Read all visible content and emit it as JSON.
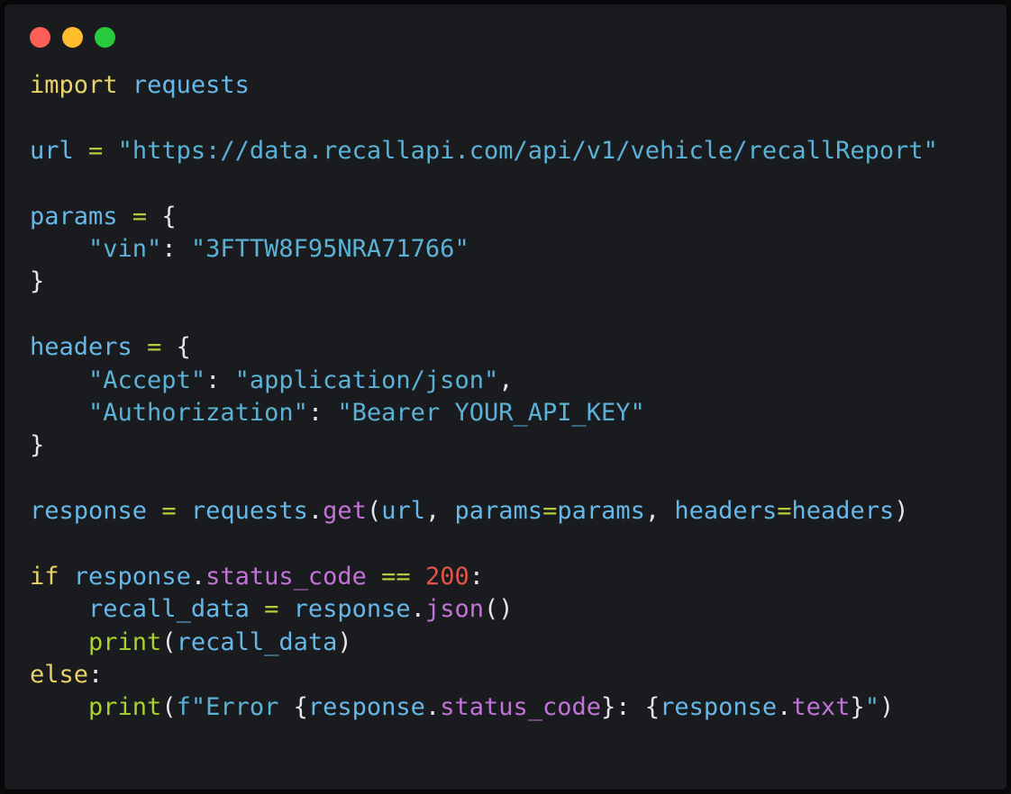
{
  "window": {
    "theme": "dark",
    "background_color": "#1a1b1e",
    "border_color": "#08080a",
    "traffic_lights": [
      {
        "name": "close",
        "label": "Close",
        "color": "#ff5f56"
      },
      {
        "name": "minimize",
        "label": "Minimize",
        "color": "#ffbd2e"
      },
      {
        "name": "maximize",
        "label": "Maximize",
        "color": "#27c93f"
      }
    ]
  },
  "editor": {
    "language": "python",
    "syntax_colors": {
      "keyword": "#e8d26a",
      "variable": "#66b8e8",
      "string": "#5ab2d6",
      "operator": "#b5cc3a",
      "punctuation": "#e6e6e6",
      "function": "#c173d6",
      "builtin": "#a6d132",
      "number": "#e2544a"
    },
    "values": {
      "module": "requests",
      "url": "https://data.recallapi.com/api/v1/vehicle/recallReport",
      "vin_key": "vin",
      "vin": "3FTTW8F95NRA71766",
      "accept_key": "Accept",
      "accept_value": "application/json",
      "authorization_key": "Authorization",
      "authorization_value": "Bearer YOUR_API_KEY",
      "status_code_ok": "200",
      "error_message": "Error"
    },
    "lines": [
      {
        "n": 1,
        "text": "import requests",
        "tokens": [
          {
            "t": "import",
            "c": "keyword"
          },
          {
            "t": " ",
            "c": "punctuation"
          },
          {
            "t": "requests",
            "c": "variable"
          }
        ]
      },
      {
        "n": 2,
        "text": "",
        "tokens": []
      },
      {
        "n": 3,
        "text": "url = \"https://data.recallapi.com/api/v1/vehicle/recallReport\"",
        "tokens": [
          {
            "t": "url",
            "c": "variable"
          },
          {
            "t": " ",
            "c": "punctuation"
          },
          {
            "t": "=",
            "c": "operator"
          },
          {
            "t": " ",
            "c": "punctuation"
          },
          {
            "t": "\"https://data.recallapi.com/api/v1/vehicle/recallReport\"",
            "c": "string"
          }
        ]
      },
      {
        "n": 4,
        "text": "",
        "tokens": []
      },
      {
        "n": 5,
        "text": "params = {",
        "tokens": [
          {
            "t": "params",
            "c": "variable"
          },
          {
            "t": " ",
            "c": "punctuation"
          },
          {
            "t": "=",
            "c": "operator"
          },
          {
            "t": " ",
            "c": "punctuation"
          },
          {
            "t": "{",
            "c": "punctuation"
          }
        ]
      },
      {
        "n": 6,
        "text": "    \"vin\": \"3FTTW8F95NRA71766\"",
        "tokens": [
          {
            "t": "    ",
            "c": "punctuation"
          },
          {
            "t": "\"vin\"",
            "c": "string"
          },
          {
            "t": ":",
            "c": "punctuation"
          },
          {
            "t": " ",
            "c": "punctuation"
          },
          {
            "t": "\"3FTTW8F95NRA71766\"",
            "c": "string"
          }
        ]
      },
      {
        "n": 7,
        "text": "}",
        "tokens": [
          {
            "t": "}",
            "c": "punctuation"
          }
        ]
      },
      {
        "n": 8,
        "text": "",
        "tokens": []
      },
      {
        "n": 9,
        "text": "headers = {",
        "tokens": [
          {
            "t": "headers",
            "c": "variable"
          },
          {
            "t": " ",
            "c": "punctuation"
          },
          {
            "t": "=",
            "c": "operator"
          },
          {
            "t": " ",
            "c": "punctuation"
          },
          {
            "t": "{",
            "c": "punctuation"
          }
        ]
      },
      {
        "n": 10,
        "text": "    \"Accept\": \"application/json\",",
        "tokens": [
          {
            "t": "    ",
            "c": "punctuation"
          },
          {
            "t": "\"Accept\"",
            "c": "string"
          },
          {
            "t": ":",
            "c": "punctuation"
          },
          {
            "t": " ",
            "c": "punctuation"
          },
          {
            "t": "\"application/json\"",
            "c": "string"
          },
          {
            "t": ",",
            "c": "punctuation"
          }
        ]
      },
      {
        "n": 11,
        "text": "    \"Authorization\": \"Bearer YOUR_API_KEY\"",
        "tokens": [
          {
            "t": "    ",
            "c": "punctuation"
          },
          {
            "t": "\"Authorization\"",
            "c": "string"
          },
          {
            "t": ":",
            "c": "punctuation"
          },
          {
            "t": " ",
            "c": "punctuation"
          },
          {
            "t": "\"Bearer YOUR_API_KEY\"",
            "c": "string"
          }
        ]
      },
      {
        "n": 12,
        "text": "}",
        "tokens": [
          {
            "t": "}",
            "c": "punctuation"
          }
        ]
      },
      {
        "n": 13,
        "text": "",
        "tokens": []
      },
      {
        "n": 14,
        "text": "response = requests.get(url, params=params, headers=headers)",
        "tokens": [
          {
            "t": "response",
            "c": "variable"
          },
          {
            "t": " ",
            "c": "punctuation"
          },
          {
            "t": "=",
            "c": "operator"
          },
          {
            "t": " ",
            "c": "punctuation"
          },
          {
            "t": "requests",
            "c": "variable"
          },
          {
            "t": ".",
            "c": "punctuation"
          },
          {
            "t": "get",
            "c": "function"
          },
          {
            "t": "(",
            "c": "punctuation"
          },
          {
            "t": "url",
            "c": "variable"
          },
          {
            "t": ",",
            "c": "punctuation"
          },
          {
            "t": " ",
            "c": "punctuation"
          },
          {
            "t": "params",
            "c": "variable"
          },
          {
            "t": "=",
            "c": "operator"
          },
          {
            "t": "params",
            "c": "variable"
          },
          {
            "t": ",",
            "c": "punctuation"
          },
          {
            "t": " ",
            "c": "punctuation"
          },
          {
            "t": "headers",
            "c": "variable"
          },
          {
            "t": "=",
            "c": "operator"
          },
          {
            "t": "headers",
            "c": "variable"
          },
          {
            "t": ")",
            "c": "punctuation"
          }
        ]
      },
      {
        "n": 15,
        "text": "",
        "tokens": []
      },
      {
        "n": 16,
        "text": "if response.status_code == 200:",
        "tokens": [
          {
            "t": "if",
            "c": "keyword"
          },
          {
            "t": " ",
            "c": "punctuation"
          },
          {
            "t": "response",
            "c": "variable"
          },
          {
            "t": ".",
            "c": "punctuation"
          },
          {
            "t": "status_code",
            "c": "function"
          },
          {
            "t": " ",
            "c": "punctuation"
          },
          {
            "t": "==",
            "c": "operator"
          },
          {
            "t": " ",
            "c": "punctuation"
          },
          {
            "t": "200",
            "c": "number"
          },
          {
            "t": ":",
            "c": "punctuation"
          }
        ]
      },
      {
        "n": 17,
        "text": "    recall_data = response.json()",
        "tokens": [
          {
            "t": "    ",
            "c": "punctuation"
          },
          {
            "t": "recall_data",
            "c": "variable"
          },
          {
            "t": " ",
            "c": "punctuation"
          },
          {
            "t": "=",
            "c": "operator"
          },
          {
            "t": " ",
            "c": "punctuation"
          },
          {
            "t": "response",
            "c": "variable"
          },
          {
            "t": ".",
            "c": "punctuation"
          },
          {
            "t": "json",
            "c": "function"
          },
          {
            "t": "()",
            "c": "punctuation"
          }
        ]
      },
      {
        "n": 18,
        "text": "    print(recall_data)",
        "tokens": [
          {
            "t": "    ",
            "c": "punctuation"
          },
          {
            "t": "print",
            "c": "builtin"
          },
          {
            "t": "(",
            "c": "punctuation"
          },
          {
            "t": "recall_data",
            "c": "variable"
          },
          {
            "t": ")",
            "c": "punctuation"
          }
        ]
      },
      {
        "n": 19,
        "text": "else:",
        "tokens": [
          {
            "t": "else",
            "c": "keyword"
          },
          {
            "t": ":",
            "c": "punctuation"
          }
        ]
      },
      {
        "n": 20,
        "text": "    print(f\"Error {response.status_code}: {response.text}\")",
        "tokens": [
          {
            "t": "    ",
            "c": "punctuation"
          },
          {
            "t": "print",
            "c": "builtin"
          },
          {
            "t": "(",
            "c": "punctuation"
          },
          {
            "t": "f\"Error ",
            "c": "string"
          },
          {
            "t": "{",
            "c": "punctuation"
          },
          {
            "t": "response",
            "c": "variable"
          },
          {
            "t": ".",
            "c": "punctuation"
          },
          {
            "t": "status_code",
            "c": "function"
          },
          {
            "t": "}",
            "c": "punctuation"
          },
          {
            "t": ":",
            "c": "punctuation"
          },
          {
            "t": " ",
            "c": "punctuation"
          },
          {
            "t": "{",
            "c": "punctuation"
          },
          {
            "t": "response",
            "c": "variable"
          },
          {
            "t": ".",
            "c": "punctuation"
          },
          {
            "t": "text",
            "c": "function"
          },
          {
            "t": "}",
            "c": "punctuation"
          },
          {
            "t": "\"",
            "c": "string"
          },
          {
            "t": ")",
            "c": "punctuation"
          }
        ]
      }
    ]
  }
}
